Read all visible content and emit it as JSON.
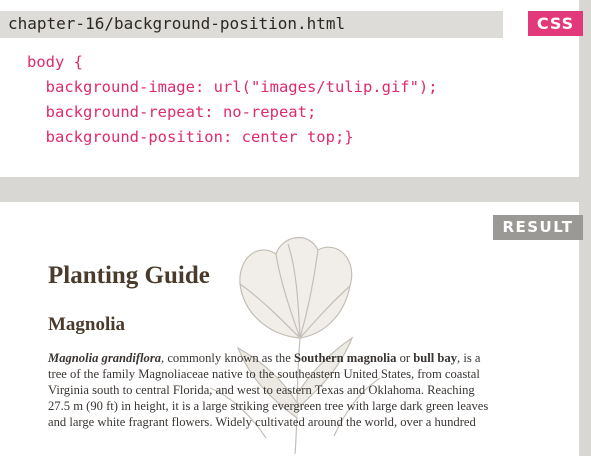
{
  "code_panel": {
    "filename": "chapter-16/background-position.html",
    "language_tag": "CSS",
    "code_lines": [
      "body {",
      "  background-image: url(\"images/tulip.gif\");",
      "  background-repeat: no-repeat;",
      "  background-position: center top;}"
    ]
  },
  "result_panel": {
    "tag": "RESULT",
    "title": "Planting Guide",
    "subtitle": "Magnolia",
    "paragraph": {
      "italic_name": "Magnolia grandiflora",
      "part1": ", commonly known as the ",
      "bold1": "Southern magnolia",
      "part2": " or ",
      "bold2": "bull bay",
      "part3": ", is a",
      "line2": "tree of the family Magnoliaceae native to the southeastern United States, from coastal",
      "line3": "Virginia south to central Florida, and west to eastern Texas and Oklahoma. Reaching",
      "line4": "27.5 m (90 ft) in height, it is a large striking evergreen tree with large dark green leaves",
      "line5": "and large white fragrant flowers. Widely cultivated around the world, over a hundred"
    },
    "background_image": "tulip-icon"
  },
  "colors": {
    "code_text": "#e02a6e",
    "css_tag": "#e2397a",
    "result_tag": "#9b9996",
    "heading": "#4a3b2c",
    "panel_band": "#d9d7d3"
  }
}
